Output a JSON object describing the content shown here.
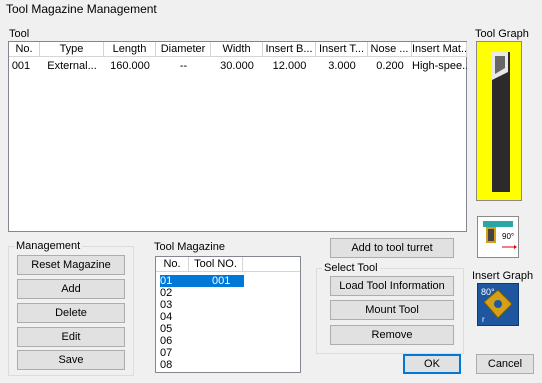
{
  "window": {
    "title": "Tool Magazine Management"
  },
  "tool_section": {
    "label": "Tool",
    "columns": [
      "No.",
      "Type",
      "Length",
      "Diameter",
      "Width",
      "Insert B...",
      "Insert T...",
      "Nose ...",
      "Insert Mat..."
    ],
    "rows": [
      [
        "001",
        "External...",
        "160.000",
        "--",
        "30.000",
        "12.000",
        "3.000",
        "0.200",
        "High-spee..."
      ]
    ]
  },
  "tool_graph": {
    "label": "Tool Graph",
    "angle_text": "90°"
  },
  "insert_graph": {
    "label": "Insert Graph",
    "angle_text": "80°",
    "r_text": "r"
  },
  "management": {
    "label": "Management",
    "buttons": [
      "Reset Magazine",
      "Add",
      "Delete",
      "Edit",
      "Save"
    ]
  },
  "tool_magazine": {
    "label": "Tool Magazine",
    "columns": [
      "No.",
      "Tool NO."
    ],
    "rows": [
      {
        "no": "01",
        "tool": "001",
        "selected": true
      },
      {
        "no": "02",
        "tool": ""
      },
      {
        "no": "03",
        "tool": ""
      },
      {
        "no": "04",
        "tool": ""
      },
      {
        "no": "05",
        "tool": ""
      },
      {
        "no": "06",
        "tool": ""
      },
      {
        "no": "07",
        "tool": ""
      },
      {
        "no": "08",
        "tool": ""
      }
    ]
  },
  "add_to_turret": "Add to tool turret",
  "select_tool": {
    "label": "Select Tool",
    "buttons": [
      "Load Tool Information",
      "Mount Tool",
      "Remove"
    ]
  },
  "ok_label": "OK",
  "cancel_label": "Cancel",
  "colors": {
    "selection": "#0078d7",
    "tool_graph_bg": "#ffff00",
    "tool_body": "#2b2b2b",
    "insert_bg": "#1e56a0",
    "insert_plate": "#d4a017"
  }
}
